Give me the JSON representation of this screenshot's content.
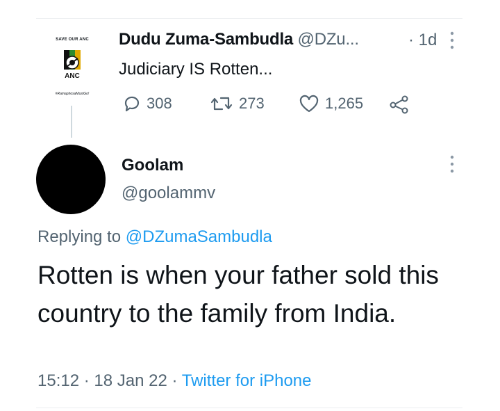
{
  "parent": {
    "avatar_top_text": "SAVE OUR ANC",
    "avatar_mid_text": "ANC",
    "avatar_bottom_text": "#RamaphosaMustGo!",
    "name": "Dudu Zuma-Sambudla",
    "handle": "@DZu...",
    "time": "· 1d",
    "text": "Judiciary IS Rotten...",
    "replies": "308",
    "retweets": "273",
    "likes": "1,265"
  },
  "reply": {
    "name": "Goolam",
    "handle": "@goolammv",
    "replying_prefix": "Replying to",
    "replying_handle": "@DZumaSambudla",
    "body": "Rotten is when your father sold this country to the family from India.",
    "time": "15:12",
    "date": "18 Jan 22",
    "separator": "·",
    "source": "Twitter for iPhone"
  },
  "colors": {
    "text": "#0f1419",
    "secondary": "#536471",
    "link": "#1d9bf0",
    "divider": "#eceef0"
  },
  "icons": [
    "reply-icon",
    "retweet-icon",
    "like-icon",
    "share-icon",
    "more-icon",
    "anc-logo"
  ]
}
